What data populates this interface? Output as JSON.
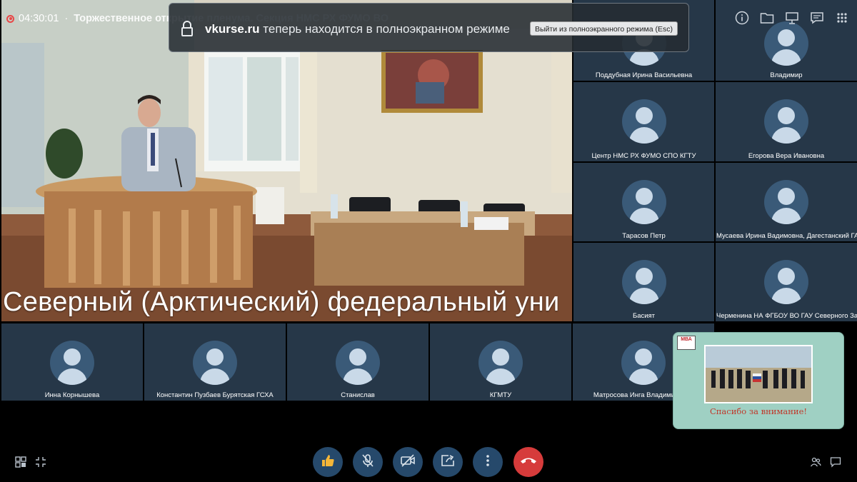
{
  "recording": {
    "timer": "04:30:01",
    "separator": "·",
    "conference_title": "Торжественное открытие пленума. Секция НМС РХ ФУМО ВО"
  },
  "fullscreen_notice": {
    "site": "vkurse.ru",
    "message": " теперь находится в полноэкранном режиме",
    "exit_button": "Выйти из полноэкранного режима (Esc)"
  },
  "main_video": {
    "caption": "Северный (Арктический) федеральный уни"
  },
  "participants_right": [
    "Поддубная Ирина Васильевна",
    "Владимир",
    "Центр НМС РХ ФУМО СПО КГТУ",
    "Егорова Вера Ивановна",
    "Тарасов Петр",
    "Мусаева Ирина Вадимовна, Дагестанский ГАУ",
    "Басият",
    "Черменина НА ФГБОУ ВО ГАУ Северного Зауралья"
  ],
  "participants_bottom": [
    "Инна Корнышева",
    "Константин Пузбаев Бурятская ГСХА",
    "Станислав",
    "КГМТУ",
    "Матросова Инга Владимировна"
  ],
  "share_preview": {
    "logo_text": "МВА",
    "thanks": "Спасибо за внимание!"
  },
  "controls": {
    "reaction": "thumbs-up-icon",
    "mic": "microphone-icon",
    "camera": "camera-off-icon",
    "share": "screen-share-icon",
    "more": "more-icon",
    "end": "end-call-icon"
  },
  "colors": {
    "tile_bg": "#263748",
    "control_bg": "#26496b",
    "end_call": "#d63b3b",
    "recording": "#e84747",
    "share_bg": "#9fd0c3"
  }
}
